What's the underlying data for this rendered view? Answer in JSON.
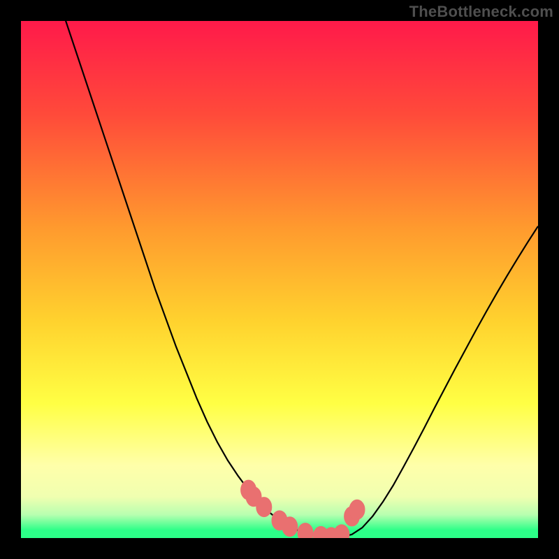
{
  "watermark": "TheBottleneck.com",
  "colors": {
    "background": "#000000",
    "gradient_top": "#ff1a4a",
    "gradient_mid_upper": "#ff7a2e",
    "gradient_mid": "#ffd22e",
    "gradient_mid_lower": "#ffff44",
    "gradient_pale": "#ffffaa",
    "gradient_green": "#2cff88",
    "curve_stroke": "#000000",
    "marker_fill": "#e97070",
    "marker_stroke": "#e97070"
  },
  "chart_data": {
    "type": "line",
    "title": "",
    "xlabel": "",
    "ylabel": "",
    "xlim": [
      0,
      100
    ],
    "ylim": [
      0,
      100
    ],
    "x": [
      0,
      2,
      4,
      6,
      8,
      10,
      12,
      14,
      16,
      18,
      20,
      22,
      24,
      26,
      28,
      30,
      32,
      34,
      36,
      38,
      40,
      42,
      44,
      46,
      48,
      50,
      52,
      54,
      56,
      58,
      60,
      62,
      64,
      66,
      68,
      70,
      72,
      74,
      76,
      78,
      80,
      82,
      84,
      86,
      88,
      90,
      92,
      94,
      96,
      98,
      100
    ],
    "series": [
      {
        "name": "bottleneck-curve",
        "values": [
          null,
          null,
          null,
          null,
          102,
          96,
          90,
          84,
          78,
          72,
          66,
          60,
          54,
          48,
          42.5,
          37,
          32,
          27,
          22.5,
          18.5,
          15,
          12,
          9.3,
          7,
          5,
          3.4,
          2.2,
          1.3,
          0.7,
          0.35,
          0.15,
          0.2,
          0.7,
          2,
          4.2,
          7,
          10.2,
          13.8,
          17.5,
          21.3,
          25.2,
          29,
          32.8,
          36.5,
          40.2,
          43.8,
          47.3,
          50.7,
          54,
          57.2,
          60.3
        ]
      }
    ],
    "markers": [
      {
        "x": 44,
        "y": 9.3
      },
      {
        "x": 45,
        "y": 8
      },
      {
        "x": 47,
        "y": 6
      },
      {
        "x": 50,
        "y": 3.4
      },
      {
        "x": 52,
        "y": 2.2
      },
      {
        "x": 55,
        "y": 1.0
      },
      {
        "x": 58,
        "y": 0.35
      },
      {
        "x": 60,
        "y": 0.15
      },
      {
        "x": 62,
        "y": 0.7
      },
      {
        "x": 64,
        "y": 4.2
      },
      {
        "x": 65,
        "y": 5.5
      }
    ],
    "gradient_stops": [
      {
        "offset": 0.0,
        "color": "#ff1a4a"
      },
      {
        "offset": 0.18,
        "color": "#ff4a3a"
      },
      {
        "offset": 0.4,
        "color": "#ff9a2e"
      },
      {
        "offset": 0.58,
        "color": "#ffd22e"
      },
      {
        "offset": 0.74,
        "color": "#ffff44"
      },
      {
        "offset": 0.86,
        "color": "#ffffaa"
      },
      {
        "offset": 0.92,
        "color": "#f0ffb0"
      },
      {
        "offset": 0.955,
        "color": "#b8ffb0"
      },
      {
        "offset": 0.985,
        "color": "#2cff88"
      },
      {
        "offset": 1.0,
        "color": "#2cff88"
      }
    ]
  }
}
